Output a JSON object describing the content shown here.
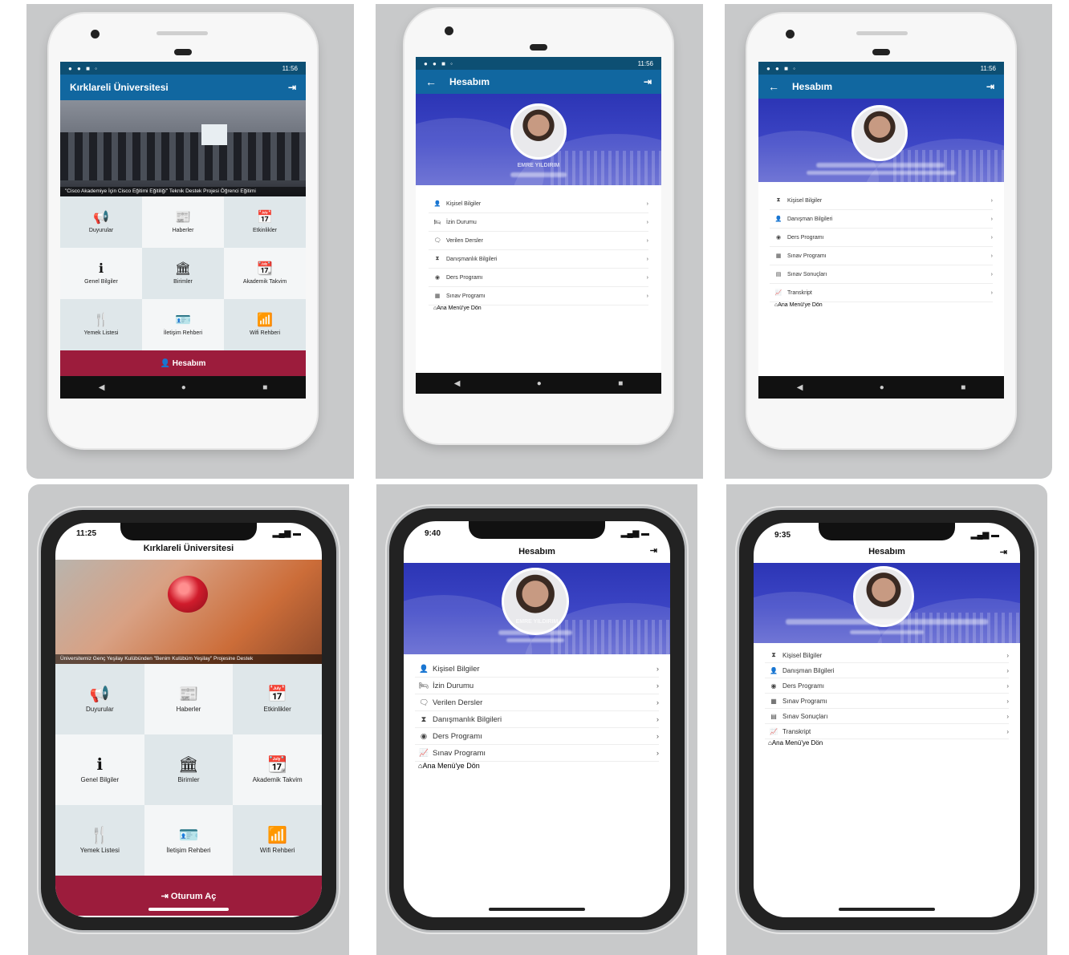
{
  "screens": {
    "s1": {
      "status_time": "11:56",
      "title": "Kırklareli Üniversitesi",
      "banner_caption": "\"Cisco Akademiye İçin Cisco Eğitimi Eğitiliği\" Teknik Destek Projesi Öğrenci Eğitimi",
      "grid": [
        {
          "icon": "📢",
          "label": "Duyurular"
        },
        {
          "icon": "📰",
          "label": "Haberler"
        },
        {
          "icon": "📅",
          "label": "Etkinlikler"
        },
        {
          "icon": "ℹ",
          "label": "Genel Bilgiler"
        },
        {
          "icon": "🏛",
          "label": "Birimler"
        },
        {
          "icon": "📆",
          "label": "Akademik Takvim"
        },
        {
          "icon": "🍴",
          "label": "Yemek Listesi"
        },
        {
          "icon": "🪪",
          "label": "İletişim Rehberi"
        },
        {
          "icon": "📶",
          "label": "Wifi Rehberi"
        }
      ],
      "bottom_button": "👤 Hesabım"
    },
    "s2": {
      "status_time": "11:56",
      "title": "Hesabım",
      "name": "EMRE YILDIRIM",
      "menu": [
        {
          "icon": "👤",
          "label": "Kişisel Bilgiler"
        },
        {
          "icon": "🛏",
          "label": "İzin Durumu"
        },
        {
          "icon": "🗨",
          "label": "Verilen Dersler"
        },
        {
          "icon": "⧗",
          "label": "Danışmanlık Bilgileri"
        },
        {
          "icon": "◉",
          "label": "Ders Programı"
        },
        {
          "icon": "▦",
          "label": "Sınav Programı"
        }
      ],
      "active": "Ana Menü'ye Dön"
    },
    "s3": {
      "status_time": "11:56",
      "title": "Hesabım",
      "menu": [
        {
          "icon": "⧗",
          "label": "Kişisel Bilgiler"
        },
        {
          "icon": "👤",
          "label": "Danışman Bilgileri"
        },
        {
          "icon": "◉",
          "label": "Ders Programı"
        },
        {
          "icon": "▦",
          "label": "Sınav Programı"
        },
        {
          "icon": "▤",
          "label": "Sınav Sonuçları"
        },
        {
          "icon": "📈",
          "label": "Transkript"
        }
      ],
      "active": "Ana Menü'ye Dön"
    },
    "s4": {
      "status_time": "11:25",
      "title": "Kırklareli Üniversitesi",
      "banner_caption": "Üniversitemiz Genç Yeşilay Kulübünden \"Benim Kulübüm Yeşilay\" Projesine Destek",
      "grid": [
        {
          "icon": "📢",
          "label": "Duyurular"
        },
        {
          "icon": "📰",
          "label": "Haberler"
        },
        {
          "icon": "📅",
          "label": "Etkinlikler"
        },
        {
          "icon": "ℹ",
          "label": "Genel Bilgiler"
        },
        {
          "icon": "🏛",
          "label": "Birimler"
        },
        {
          "icon": "📆",
          "label": "Akademik Takvim"
        },
        {
          "icon": "🍴",
          "label": "Yemek Listesi"
        },
        {
          "icon": "🪪",
          "label": "İletişim Rehberi"
        },
        {
          "icon": "📶",
          "label": "Wifi Rehberi"
        }
      ],
      "bottom_button": "⇥ Oturum Aç"
    },
    "s5": {
      "status_time": "9:40",
      "title": "Hesabım",
      "name": "EMRE YILDIRIM",
      "menu": [
        {
          "icon": "👤",
          "label": "Kişisel Bilgiler"
        },
        {
          "icon": "🛏",
          "label": "İzin Durumu"
        },
        {
          "icon": "🗨",
          "label": "Verilen Dersler"
        },
        {
          "icon": "⧗",
          "label": "Danışmanlık Bilgileri"
        },
        {
          "icon": "◉",
          "label": "Ders Programı"
        },
        {
          "icon": "📈",
          "label": "Sınav Programı"
        }
      ],
      "active": "Ana Menü'ye Dön"
    },
    "s6": {
      "status_time": "9:35",
      "title": "Hesabım",
      "menu": [
        {
          "icon": "⧗",
          "label": "Kişisel Bilgiler"
        },
        {
          "icon": "👤",
          "label": "Danışman Bilgileri"
        },
        {
          "icon": "◉",
          "label": "Ders Programı"
        },
        {
          "icon": "▦",
          "label": "Sınav Programı"
        },
        {
          "icon": "▤",
          "label": "Sınav Sonuçları"
        },
        {
          "icon": "📈",
          "label": "Transkript"
        }
      ],
      "active": "Ana Menü'ye Dön"
    }
  },
  "colors": {
    "appbar": "#1167a0",
    "status": "#0d4f73",
    "accent": "#9c1c3c",
    "profile": "#3d46c6"
  }
}
